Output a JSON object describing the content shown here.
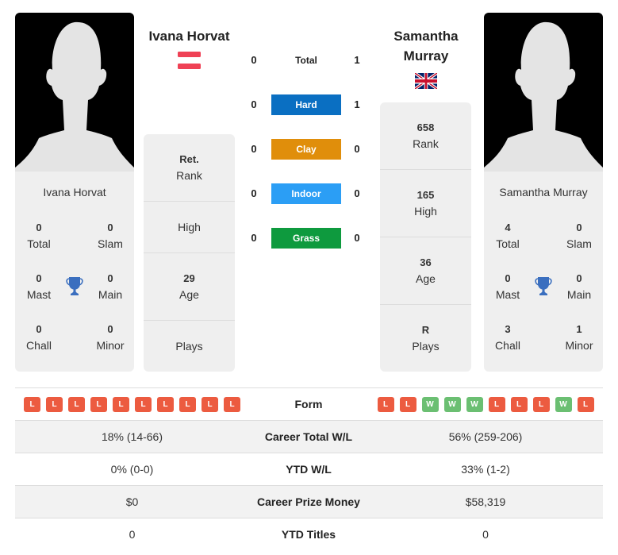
{
  "colors": {
    "hard": "#0a6fc2",
    "clay": "#e08e0b",
    "indoor": "#2b9ef5",
    "grass": "#0e9a3e",
    "loss": "#ec5b40",
    "win": "#6bbf72",
    "trophy": "#3b6fbf"
  },
  "player1": {
    "name": "Ivana Horvat",
    "flag": "austria-flag",
    "photo": "silhouette-placeholder",
    "titles": {
      "total": {
        "value": "0",
        "label": "Total"
      },
      "slam": {
        "value": "0",
        "label": "Slam"
      },
      "mast": {
        "value": "0",
        "label": "Mast"
      },
      "main": {
        "value": "0",
        "label": "Main"
      },
      "chall": {
        "value": "0",
        "label": "Chall"
      },
      "minor": {
        "value": "0",
        "label": "Minor"
      }
    },
    "rank_panel": [
      {
        "value": "Ret.",
        "label": "Rank"
      },
      {
        "value": "",
        "label": "High"
      },
      {
        "value": "29",
        "label": "Age"
      },
      {
        "value": "",
        "label": "Plays"
      }
    ],
    "form": [
      "L",
      "L",
      "L",
      "L",
      "L",
      "L",
      "L",
      "L",
      "L",
      "L"
    ]
  },
  "player2": {
    "name": "Samantha Murray",
    "flag": "uk-flag",
    "photo": "silhouette-placeholder",
    "titles": {
      "total": {
        "value": "4",
        "label": "Total"
      },
      "slam": {
        "value": "0",
        "label": "Slam"
      },
      "mast": {
        "value": "0",
        "label": "Mast"
      },
      "main": {
        "value": "0",
        "label": "Main"
      },
      "chall": {
        "value": "3",
        "label": "Chall"
      },
      "minor": {
        "value": "1",
        "label": "Minor"
      }
    },
    "rank_panel": [
      {
        "value": "658",
        "label": "Rank"
      },
      {
        "value": "165",
        "label": "High"
      },
      {
        "value": "36",
        "label": "Age"
      },
      {
        "value": "R",
        "label": "Plays"
      }
    ],
    "form": [
      "L",
      "L",
      "W",
      "W",
      "W",
      "L",
      "L",
      "L",
      "W",
      "L"
    ]
  },
  "h2h": [
    {
      "label": "Total",
      "p1": "0",
      "p2": "1"
    },
    {
      "label": "Hard",
      "p1": "0",
      "p2": "1"
    },
    {
      "label": "Clay",
      "p1": "0",
      "p2": "0"
    },
    {
      "label": "Indoor",
      "p1": "0",
      "p2": "0"
    },
    {
      "label": "Grass",
      "p1": "0",
      "p2": "0"
    }
  ],
  "comparison": {
    "form_label": "Form",
    "rows": [
      {
        "label": "Career Total W/L",
        "p1": "18% (14-66)",
        "p2": "56% (259-206)"
      },
      {
        "label": "YTD W/L",
        "p1": "0% (0-0)",
        "p2": "33% (1-2)"
      },
      {
        "label": "Career Prize Money",
        "p1": "$0",
        "p2": "$58,319"
      },
      {
        "label": "YTD Titles",
        "p1": "0",
        "p2": "0"
      }
    ]
  }
}
